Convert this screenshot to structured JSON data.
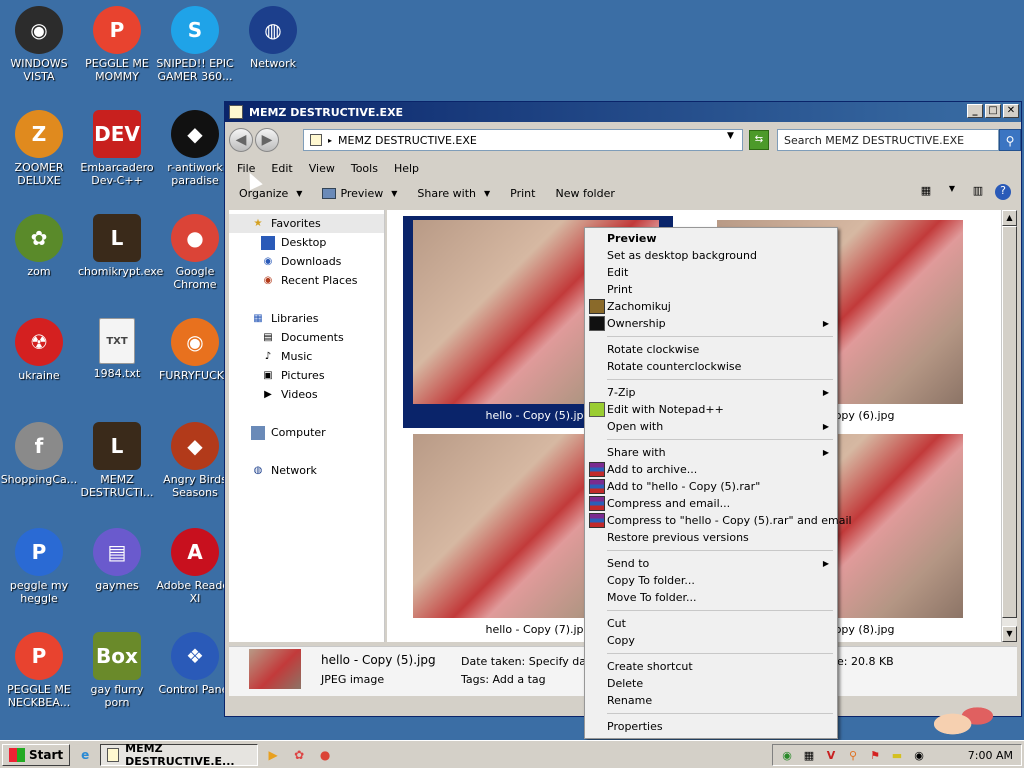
{
  "desktop": {
    "icons": [
      {
        "label": "WINDOWS VISTA",
        "glyph": "◉",
        "color": "#2c2c2c"
      },
      {
        "label": "PEGGLE ME MOMMY",
        "glyph": "P",
        "color": "#e8432f"
      },
      {
        "label": "SNIPED!! EPIC GAMER 360...",
        "glyph": "S",
        "color": "#1fa3e8"
      },
      {
        "label": "Network",
        "glyph": "◍",
        "color": "#1c3f8c"
      },
      {
        "label": "ZOOMER DELUXE",
        "glyph": "Z",
        "color": "#e08a1e"
      },
      {
        "label": "Embarcadero Dev-C++",
        "glyph": "DEV",
        "color": "#c8201e"
      },
      {
        "label": "r-antiwork paradise",
        "glyph": "◆",
        "color": "#111111"
      },
      {
        "label": "zom",
        "glyph": "✿",
        "color": "#5a8a2a"
      },
      {
        "label": "chomikrypt.exe",
        "glyph": "L",
        "color": "#3a2a1a"
      },
      {
        "label": "Google Chrome",
        "glyph": "●",
        "color": "#db4437"
      },
      {
        "label": "ukraine",
        "glyph": "☢",
        "color": "#d42020"
      },
      {
        "label": "1984.txt",
        "glyph": "TXT",
        "color": "#f4f4f4"
      },
      {
        "label": "FURRYFUCKS",
        "glyph": "◉",
        "color": "#e8711e"
      },
      {
        "label": "ShoppingCa...",
        "glyph": "f",
        "color": "#8a8a8a"
      },
      {
        "label": "MEMZ DESTRUCTI...",
        "glyph": "L",
        "color": "#3a2a1a"
      },
      {
        "label": "Angry Birds Seasons",
        "glyph": "◆",
        "color": "#b23a1a"
      },
      {
        "label": "peggle my heggle",
        "glyph": "P",
        "color": "#2a6ad4"
      },
      {
        "label": "gaymes",
        "glyph": "▤",
        "color": "#6a5acd"
      },
      {
        "label": "Adobe Reader XI",
        "glyph": "A",
        "color": "#c8101e"
      },
      {
        "label": "PEGGLE ME NECKBEA...",
        "glyph": "P",
        "color": "#e8432f"
      },
      {
        "label": "gay flurry porn",
        "glyph": "Box",
        "color": "#6a8a2a"
      },
      {
        "label": "Control Panel",
        "glyph": "❖",
        "color": "#2a5ab8"
      }
    ]
  },
  "window": {
    "title": "MEMZ DESTRUCTIVE.EXE",
    "controls": {
      "minimize": "_",
      "maximize": "□",
      "close": "✕"
    },
    "address": "MEMZ DESTRUCTIVE.EXE",
    "search_placeholder": "Search MEMZ DESTRUCTIVE.EXE",
    "menu": [
      "File",
      "Edit",
      "View",
      "Tools",
      "Help"
    ],
    "toolbar": {
      "organize": "Organize",
      "preview": "Preview",
      "share": "Share with",
      "print": "Print",
      "new_folder": "New folder"
    },
    "nav": {
      "favorites": "Favorites",
      "fav_items": [
        "Desktop",
        "Downloads",
        "Recent Places"
      ],
      "libraries": "Libraries",
      "lib_items": [
        "Documents",
        "Music",
        "Pictures",
        "Videos"
      ],
      "computer": "Computer",
      "network": "Network"
    },
    "files": [
      {
        "name": "hello - Copy (5).jpg",
        "selected": true
      },
      {
        "name": "hello - Copy (6).jpg",
        "selected": false
      },
      {
        "name": "hello - Copy (7).jpg",
        "selected": false
      },
      {
        "name": "hello - Copy (8).jpg",
        "selected": false
      }
    ],
    "details": {
      "filename": "hello - Copy (5).jpg",
      "type": "JPEG image",
      "date_taken": "Date taken: Specify date taken",
      "tags": "Tags: Add a tag",
      "size": "e: 20.8 KB"
    }
  },
  "context_menu": {
    "preview": "Preview",
    "set_bg": "Set as desktop background",
    "edit": "Edit",
    "print": "Print",
    "zachomikuj": "Zachomikuj",
    "ownership": "Ownership",
    "rotate_cw": "Rotate clockwise",
    "rotate_ccw": "Rotate counterclockwise",
    "zip": "7-Zip",
    "notepad": "Edit with Notepad++",
    "open_with": "Open with",
    "share_with": "Share with",
    "add_archive": "Add to archive...",
    "add_rar": "Add to \"hello - Copy (5).rar\"",
    "compress_email": "Compress and email...",
    "compress_rar_email": "Compress to \"hello - Copy (5).rar\" and email",
    "restore": "Restore previous versions",
    "send_to": "Send to",
    "copy_to": "Copy To folder...",
    "move_to": "Move To folder...",
    "cut": "Cut",
    "copy": "Copy",
    "create_shortcut": "Create shortcut",
    "delete": "Delete",
    "rename": "Rename",
    "properties": "Properties"
  },
  "taskbar": {
    "start": "Start",
    "task": "MEMZ DESTRUCTIVE.E...",
    "clock": "7:00 AM"
  }
}
